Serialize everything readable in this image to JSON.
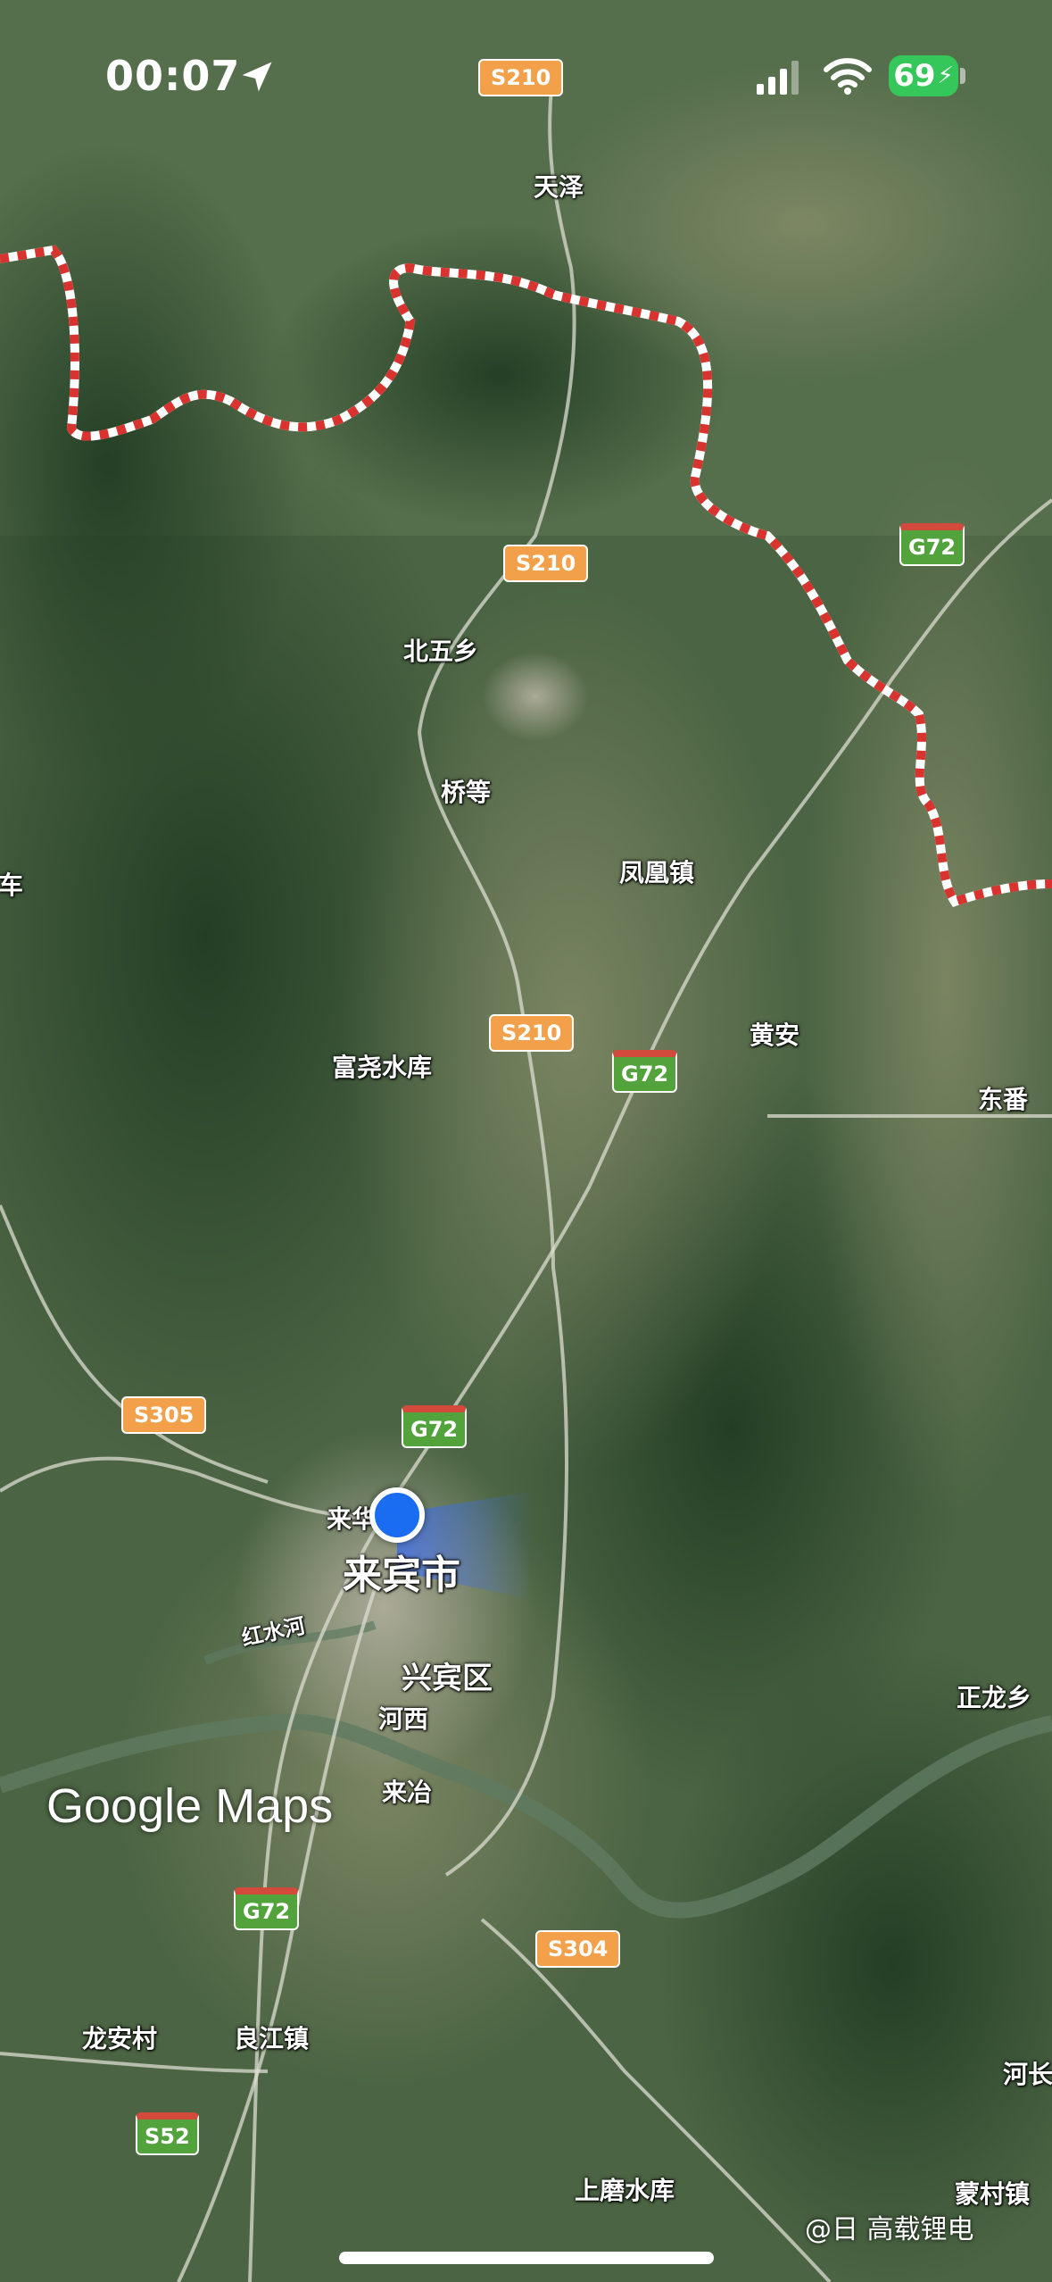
{
  "status_bar": {
    "time": "00:07",
    "battery": "69",
    "icons": [
      "location-arrow-icon",
      "signal-icon",
      "wifi-icon",
      "battery-charging-icon"
    ]
  },
  "map": {
    "provider_logo": "Google Maps",
    "type": "satellite",
    "places": {
      "tianze": "天泽",
      "beiwu": "北五乡",
      "qiaodeng": "桥等",
      "fenghuang": "凤凰镇",
      "luche": "路车",
      "huangan": "黄安",
      "fuyao": "富尧水库",
      "dongfan": "东番",
      "laihua": "来华",
      "laibin": "来宾市",
      "hongshuihe": "红水河",
      "xingbin": "兴宾区",
      "hexi": "河西",
      "laiye": "来冶",
      "zhenglong": "正龙乡",
      "longan": "龙安村",
      "liangjiang": "良江镇",
      "shangmo": "上磨水库",
      "hechang": "河长",
      "mengcun": "蒙村镇"
    },
    "roads": {
      "s210_a": "S210",
      "s210_b": "S210",
      "s210_c": "S210",
      "g72_a": "G72",
      "g72_b": "G72",
      "g72_c": "G72",
      "g72_d": "G72",
      "s305": "S305",
      "s304": "S304",
      "s52": "S52"
    }
  },
  "watermark": "@日   高载锂电",
  "colors": {
    "border": "#d8332f",
    "user_location": "#1a6cf0",
    "provincial_shield": "#f2a04a",
    "national_shield": "#52a33b"
  }
}
